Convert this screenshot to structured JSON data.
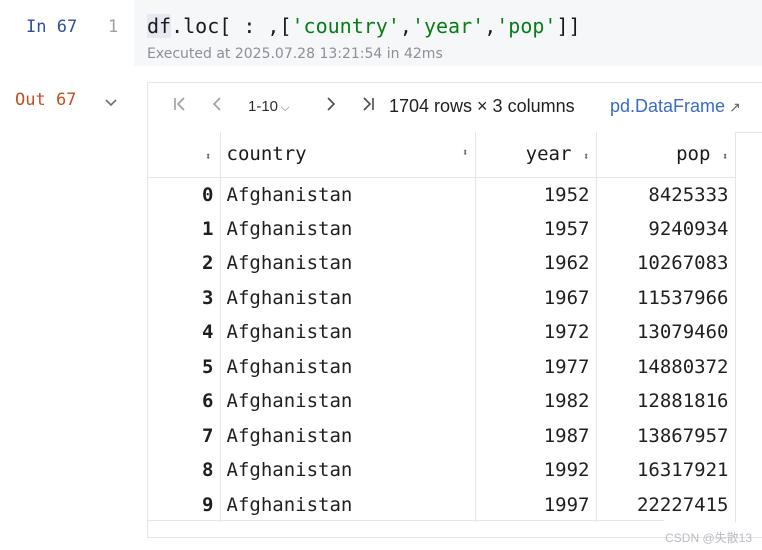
{
  "input_cell": {
    "prompt": "In 67",
    "line_number": "1",
    "code": {
      "prefix_hl": "df",
      "prefix_rest": ".loc[ : ,[",
      "str1": "'country'",
      "comma1": ",",
      "str2": "'year'",
      "comma2": ",",
      "str3": "'pop'",
      "suffix": "]]"
    },
    "exec_info": "Executed at 2025.07.28 13:21:54 in 42ms"
  },
  "output_cell": {
    "prompt": "Out 67",
    "toolbar": {
      "first_icon": "|‹",
      "prev_icon": "‹",
      "range": "1-10",
      "next_icon": "›",
      "last_icon": "›|",
      "rows_info": "1704 rows × 3 columns",
      "df_type": "pd.DataFrame",
      "open_icon": "↗"
    },
    "columns": [
      "country",
      "year",
      "pop"
    ],
    "rows": [
      {
        "idx": "0",
        "country": "Afghanistan",
        "year": "1952",
        "pop": "8425333"
      },
      {
        "idx": "1",
        "country": "Afghanistan",
        "year": "1957",
        "pop": "9240934"
      },
      {
        "idx": "2",
        "country": "Afghanistan",
        "year": "1962",
        "pop": "10267083"
      },
      {
        "idx": "3",
        "country": "Afghanistan",
        "year": "1967",
        "pop": "11537966"
      },
      {
        "idx": "4",
        "country": "Afghanistan",
        "year": "1972",
        "pop": "13079460"
      },
      {
        "idx": "5",
        "country": "Afghanistan",
        "year": "1977",
        "pop": "14880372"
      },
      {
        "idx": "6",
        "country": "Afghanistan",
        "year": "1982",
        "pop": "12881816"
      },
      {
        "idx": "7",
        "country": "Afghanistan",
        "year": "1987",
        "pop": "13867957"
      },
      {
        "idx": "8",
        "country": "Afghanistan",
        "year": "1992",
        "pop": "16317921"
      },
      {
        "idx": "9",
        "country": "Afghanistan",
        "year": "1997",
        "pop": "22227415"
      }
    ]
  },
  "watermark": "CSDN @失散13",
  "colors": {
    "in_prompt": "#2e4f9e",
    "out_prompt": "#c4501f",
    "string": "#067d17",
    "link": "#3a6bc7"
  }
}
